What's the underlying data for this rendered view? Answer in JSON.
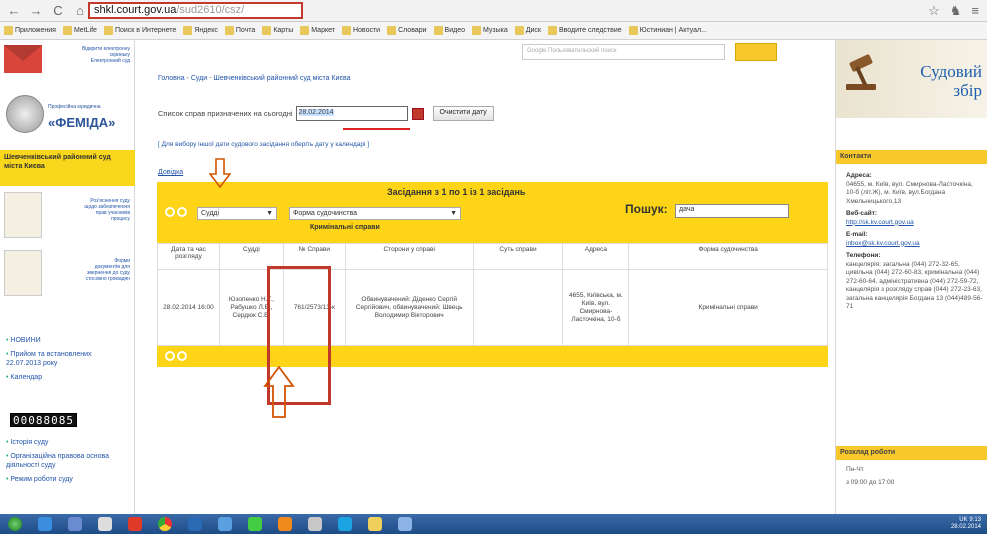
{
  "browser": {
    "url_host": "shkl.court.gov.ua",
    "url_path": "/sud2610/csz/",
    "bookmarks": [
      "Приложения",
      "MetLife",
      "Поиск в Интернете",
      "Яндекс",
      "Почта",
      "Карты",
      "Маркет",
      "Новости",
      "Словари",
      "Видео",
      "Музыка",
      "Диск",
      "Вводите следствие",
      "Юстиниан | Актуал..."
    ]
  },
  "left_sidebar": {
    "femida_title": "«ФЕМІДА»",
    "femida_sub": "Професійна юридична",
    "court_name": "Шевченківський районний суд міста Києва",
    "news_items": [
      "НОВИНИ",
      "Прийом та встановлених 22.07.2013 року",
      "Календар",
      "Історія суду",
      "Організаційна правова основа діяльності суду",
      "Режим роботи суду"
    ],
    "counter": "00088085"
  },
  "main": {
    "search_placeholder": "Google Пользовательский поиск",
    "breadcrumb": [
      "Головна",
      "Суди",
      "Шевченківський районний суд міста Києва"
    ],
    "date_label": "Список справ призначених на сьогодні",
    "date_value": "28.02.2014",
    "clear_date_label": "Очистити дату",
    "hint": "[ Для вибору іншої дати судового засідання оберіть дату у календарі ]",
    "help_link": "Довідка",
    "results": {
      "title": "Засідання з 1 по 1 із 1 засідань",
      "judges_select": "Судді",
      "proceeding_select": "Форма судочинства",
      "proceeding_sub": "Кримінальні справи",
      "search_label": "Пошук:",
      "search_value": "дача",
      "columns": [
        "Дата та час розгляду",
        "Судді",
        "№ Справи",
        "Сторони у справі",
        "Суть справи",
        "Адреса",
        "Форма судочинства"
      ],
      "rows": [
        {
          "datetime": "28.02.2014 16:00",
          "judges": "Юзопенко Н.Г., Рабушко Л.В., Сердюк С.В.",
          "case_no": "761/2573/13-к",
          "parties": "Обвинувачений: Діденко Сергій Сергійович, обвинувачений: Швець Володимир Вікторович",
          "essence": "",
          "address": "4655, Київська, м. Київ, вул. Смирнова-Ласточкіна, 10-б",
          "form": "Кримінальні справи"
        }
      ]
    }
  },
  "right_sidebar": {
    "fee_title_1": "Судовий",
    "fee_title_2": "збір",
    "contacts_title": "Контакти",
    "address_label": "Адреса:",
    "address": "04655, м. Київ, вул. Смирнова-Ласточкіна, 10-б (літ.Ж), м. Київ, вул.Богдана Хмельницького,13",
    "website_label": "Веб-сайт:",
    "website": "http://sk.kv.court.gov.ua",
    "email_label": "E-mail:",
    "email": "inbox@sk.kv.court.gov.ua",
    "phones_label": "Телефони:",
    "phones": "канцелярія: загальна (044) 272-32-65, цивільна (044) 272-60-83, кримінальна (044) 272-60-64, адміністративна (044) 272-59-72, канцелярія з розгляду справ (044) 272-23-63, загальна канцелярія Богдана 13 (044)489-56-71",
    "schedule_title": "Розклад роботи",
    "schedule_day": "Пн-Чт",
    "schedule_time": "з 09:00 до 17:00"
  },
  "taskbar": {
    "lang": "UK",
    "time": "9:13",
    "date": "28.02.2014"
  },
  "colors": {
    "accent_yellow": "#fdd416",
    "highlight_red": "#c0392b",
    "link_blue": "#2255aa"
  }
}
